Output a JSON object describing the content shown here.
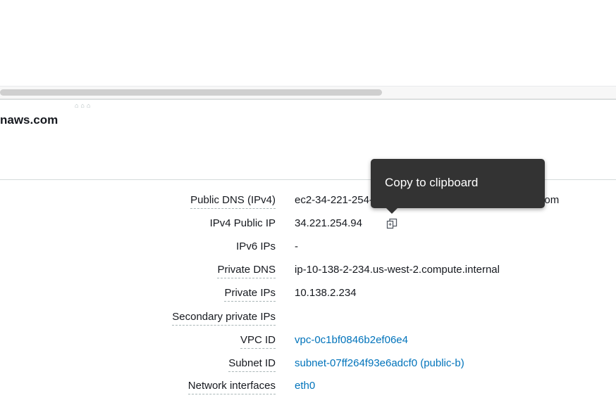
{
  "instance": {
    "title_fragment": "naws.com"
  },
  "details": [
    {
      "label": "Public DNS (IPv4)",
      "value": "ec2-34-221-254-94.us-west-2.compute.amazonaws.com",
      "link": false
    },
    {
      "label": "IPv4 Public IP",
      "value": "34.221.254.94",
      "link": false
    },
    {
      "label": "IPv6 IPs",
      "value": "-",
      "link": false
    },
    {
      "label": "Private DNS",
      "value": "ip-10-138-2-234.us-west-2.compute.internal",
      "link": false
    },
    {
      "label": "Private IPs",
      "value": "10.138.2.234",
      "link": false
    },
    {
      "label": "Secondary private IPs",
      "value": "",
      "link": false
    },
    {
      "label": "VPC ID",
      "value": "vpc-0c1bf0846b2ef06e4",
      "link": true
    },
    {
      "label": "Subnet ID",
      "value": "subnet-07ff264f93e6adcf0 (public-b)",
      "link": true
    },
    {
      "label": "Network interfaces",
      "value": "eth0",
      "link": true
    }
  ],
  "tooltip": {
    "text": "Copy to clipboard"
  },
  "icons": {
    "copy": "copy-icon",
    "resize_handle": "drag-handle-icon"
  },
  "colors": {
    "link": "#0073bb",
    "tooltip_bg": "#333333"
  }
}
